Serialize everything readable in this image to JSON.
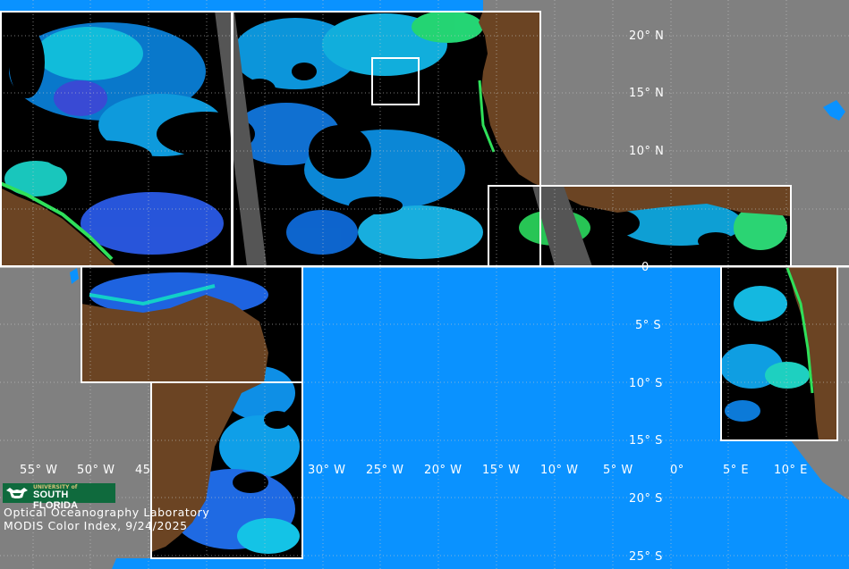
{
  "map": {
    "lat_labels": [
      "20° N",
      "15° N",
      "10° N",
      "0",
      "5° S",
      "10° S",
      "15° S",
      "20° S",
      "25° S"
    ],
    "lon_labels": [
      "55° W",
      "50° W",
      "45",
      "30° W",
      "25° W",
      "20° W",
      "15° W",
      "10° W",
      "5° W",
      "0°",
      "5° E",
      "10° E"
    ]
  },
  "logo": {
    "line1": "UNIVERSITY of",
    "line2": "SOUTH FLORIDA"
  },
  "footer": {
    "lab": "Optical Oceanography Laboratory",
    "product": "MODIS Color Index, 9/24/2025"
  },
  "colors": {
    "background": "#808080",
    "land": "#6b4423",
    "ocean_nodata": "#0a92ff",
    "gap": "#555555",
    "frame": "#ffffff"
  }
}
